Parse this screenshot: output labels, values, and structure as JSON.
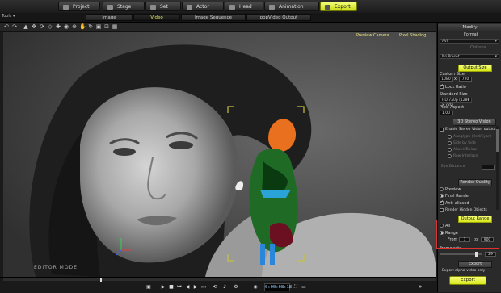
{
  "main_tabs": [
    "Project",
    "Stage",
    "Set",
    "Actor",
    "Head",
    "Animation",
    "Export"
  ],
  "sub_tabs": [
    "Image",
    "Video",
    "Image Sequence",
    "popVideo Output"
  ],
  "toolbar": {
    "left_label": "Tools ▾"
  },
  "viewport": {
    "preview_camera": "Preview Camera",
    "pixel_shading": "Pixel Shading",
    "editor_mode": "EDITOR MODE"
  },
  "panel": {
    "title": "Modify",
    "format_label": "Format",
    "format_value": "AVI",
    "options_label": "Options",
    "preset_value": "No Preset",
    "output_size": "Output Size",
    "custom_size": "Custom Size",
    "width": "1080",
    "height": "720",
    "lock_ratio": "Lock Ratio",
    "standard_size": "Standard Size",
    "standard_size_value": "HD 720p (1280 x 720)",
    "pixel_aspect": "Pixel Aspect",
    "pixel_aspect_value": "1.00",
    "stereo_value": "3D Stereo Vision",
    "enable_stereo": "Enable Stereo Vision output",
    "stereo_opts": [
      "Anaglyph (Red/Cyan)",
      "Side by Side",
      "Above/Below",
      "Row Interlace"
    ],
    "eye_distance": "Eye Distance",
    "render_quality": "Render Quality",
    "preview": "Preview",
    "final_render": "Final Render",
    "anti_aliased": "Anti-aliased",
    "render_hidden": "Render Hidden Objects",
    "output_range": "Output Range",
    "all": "All",
    "range": "Range",
    "from_label": "From",
    "from_value": "1",
    "to_label": "to",
    "to_value": "900",
    "frame_rate": "Frame rate",
    "frame_rate_value": "29",
    "export_section": "Export",
    "export_alpha": "Export alpha video only",
    "export_button": "Export"
  },
  "playback": {
    "timecode": "0:00:08:18"
  },
  "colors": {
    "accent": "#dfee3a",
    "highlight_box": "#e03030"
  }
}
